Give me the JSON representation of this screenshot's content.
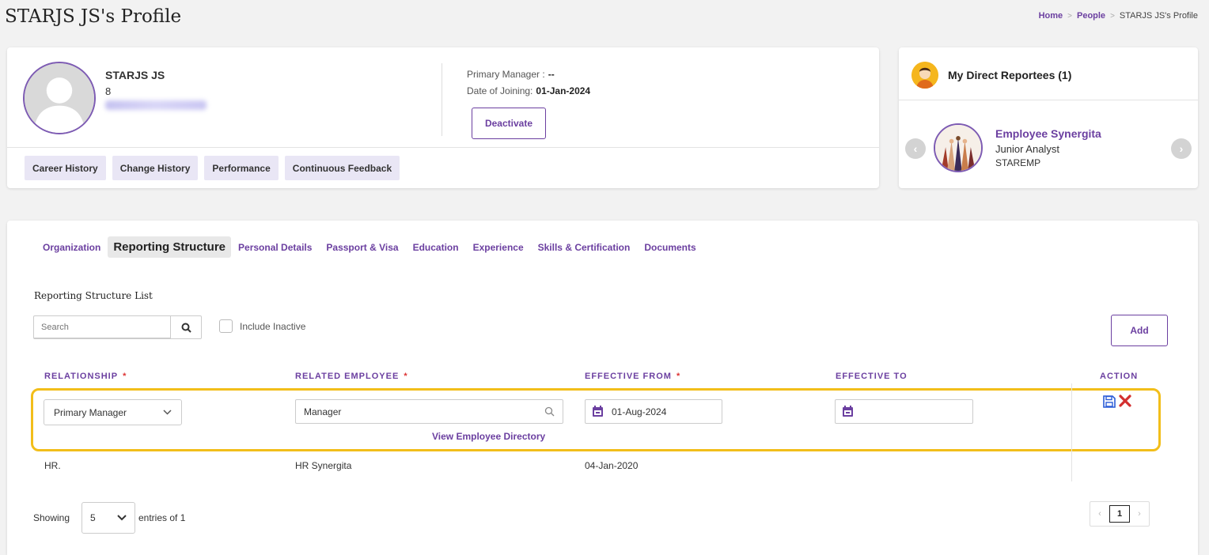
{
  "header": {
    "title": "STARJS JS's Profile",
    "breadcrumb": [
      "Home",
      "People",
      "STARJS JS's Profile"
    ]
  },
  "profile": {
    "name": "STARJS JS",
    "code": "8",
    "primary_manager_label": "Primary Manager :",
    "primary_manager_value": "--",
    "doj_label": "Date of Joining:",
    "doj_value": "01-Jan-2024",
    "deactivate_label": "Deactivate",
    "tabs": [
      "Career History",
      "Change History",
      "Performance",
      "Continuous Feedback"
    ]
  },
  "reportees": {
    "title": "My Direct Reportees (1)",
    "item": {
      "name": "Employee Synergita",
      "role": "Junior Analyst",
      "code": "STAREMP"
    }
  },
  "section_tabs": {
    "items": [
      "Organization",
      "Reporting Structure",
      "Personal Details",
      "Passport & Visa",
      "Education",
      "Experience",
      "Skills & Certification",
      "Documents"
    ],
    "active_index": 1
  },
  "list": {
    "title": "Reporting Structure List",
    "search_placeholder": "Search",
    "include_inactive_label": "Include Inactive",
    "add_label": "Add",
    "columns": {
      "relationship": "RELATIONSHIP",
      "related_employee": "RELATED EMPLOYEE",
      "effective_from": "EFFECTIVE FROM",
      "effective_to": "EFFECTIVE TO",
      "action": "ACTION"
    },
    "required_mark": "*",
    "edit_row": {
      "relationship": "Primary Manager",
      "related_employee": "Manager",
      "view_directory": "View Employee Directory",
      "effective_from": "01-Aug-2024",
      "effective_to": ""
    },
    "rows": [
      {
        "relationship": "HR.",
        "related_employee": "HR Synergita",
        "effective_from": "04-Jan-2020",
        "effective_to": ""
      }
    ],
    "footer": {
      "showing": "Showing",
      "page_size": "5",
      "entries_text": "entries of 1",
      "current_page": "1",
      "prev": "‹",
      "next": "›"
    }
  },
  "colors": {
    "accent": "#6b3fa0",
    "highlight": "#f2be1a",
    "danger": "#d32f2f"
  }
}
